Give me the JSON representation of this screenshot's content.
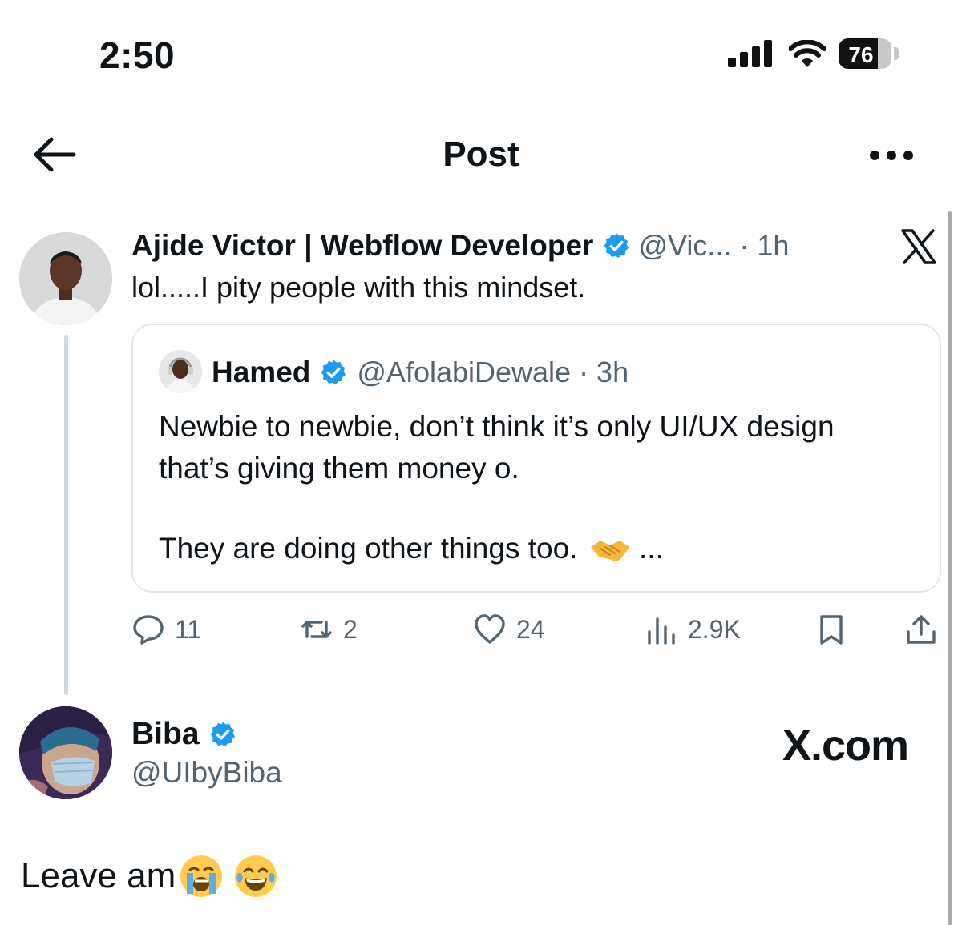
{
  "status_bar": {
    "time": "2:50",
    "battery": "76"
  },
  "header": {
    "title": "Post"
  },
  "tweet": {
    "author_name": "Ajide Victor | Webflow Developer",
    "handle_time": "@Vic... · 1h",
    "text": "lol.....I pity people with this mindset.",
    "quote": {
      "author_name": "Hamed",
      "handle_time": "@AfolabiDewale · 3h",
      "line1": "Newbie to newbie, don’t think it’s only UI/UX design",
      "line2": "that’s giving them money o.",
      "line3": "They are doing other things too.",
      "line3_suffix": "..."
    },
    "stats": {
      "replies": "11",
      "reposts": "2",
      "likes": "24",
      "views": "2.9K"
    }
  },
  "reply_user": {
    "name": "Biba",
    "handle": "@UIbyBiba"
  },
  "watermark": "X.com",
  "reply_text": "Leave am",
  "colors": {
    "verified": "#1d9bf0",
    "secondary_text": "#536471",
    "border": "#e1e8ed"
  },
  "icons": [
    "back-arrow-icon",
    "more-icon",
    "x-logo-icon",
    "verified-icon",
    "reply-icon",
    "repost-icon",
    "like-icon",
    "views-icon",
    "bookmark-icon",
    "share-icon",
    "crying-emoji",
    "laughing-emoji",
    "handshake-emoji"
  ]
}
